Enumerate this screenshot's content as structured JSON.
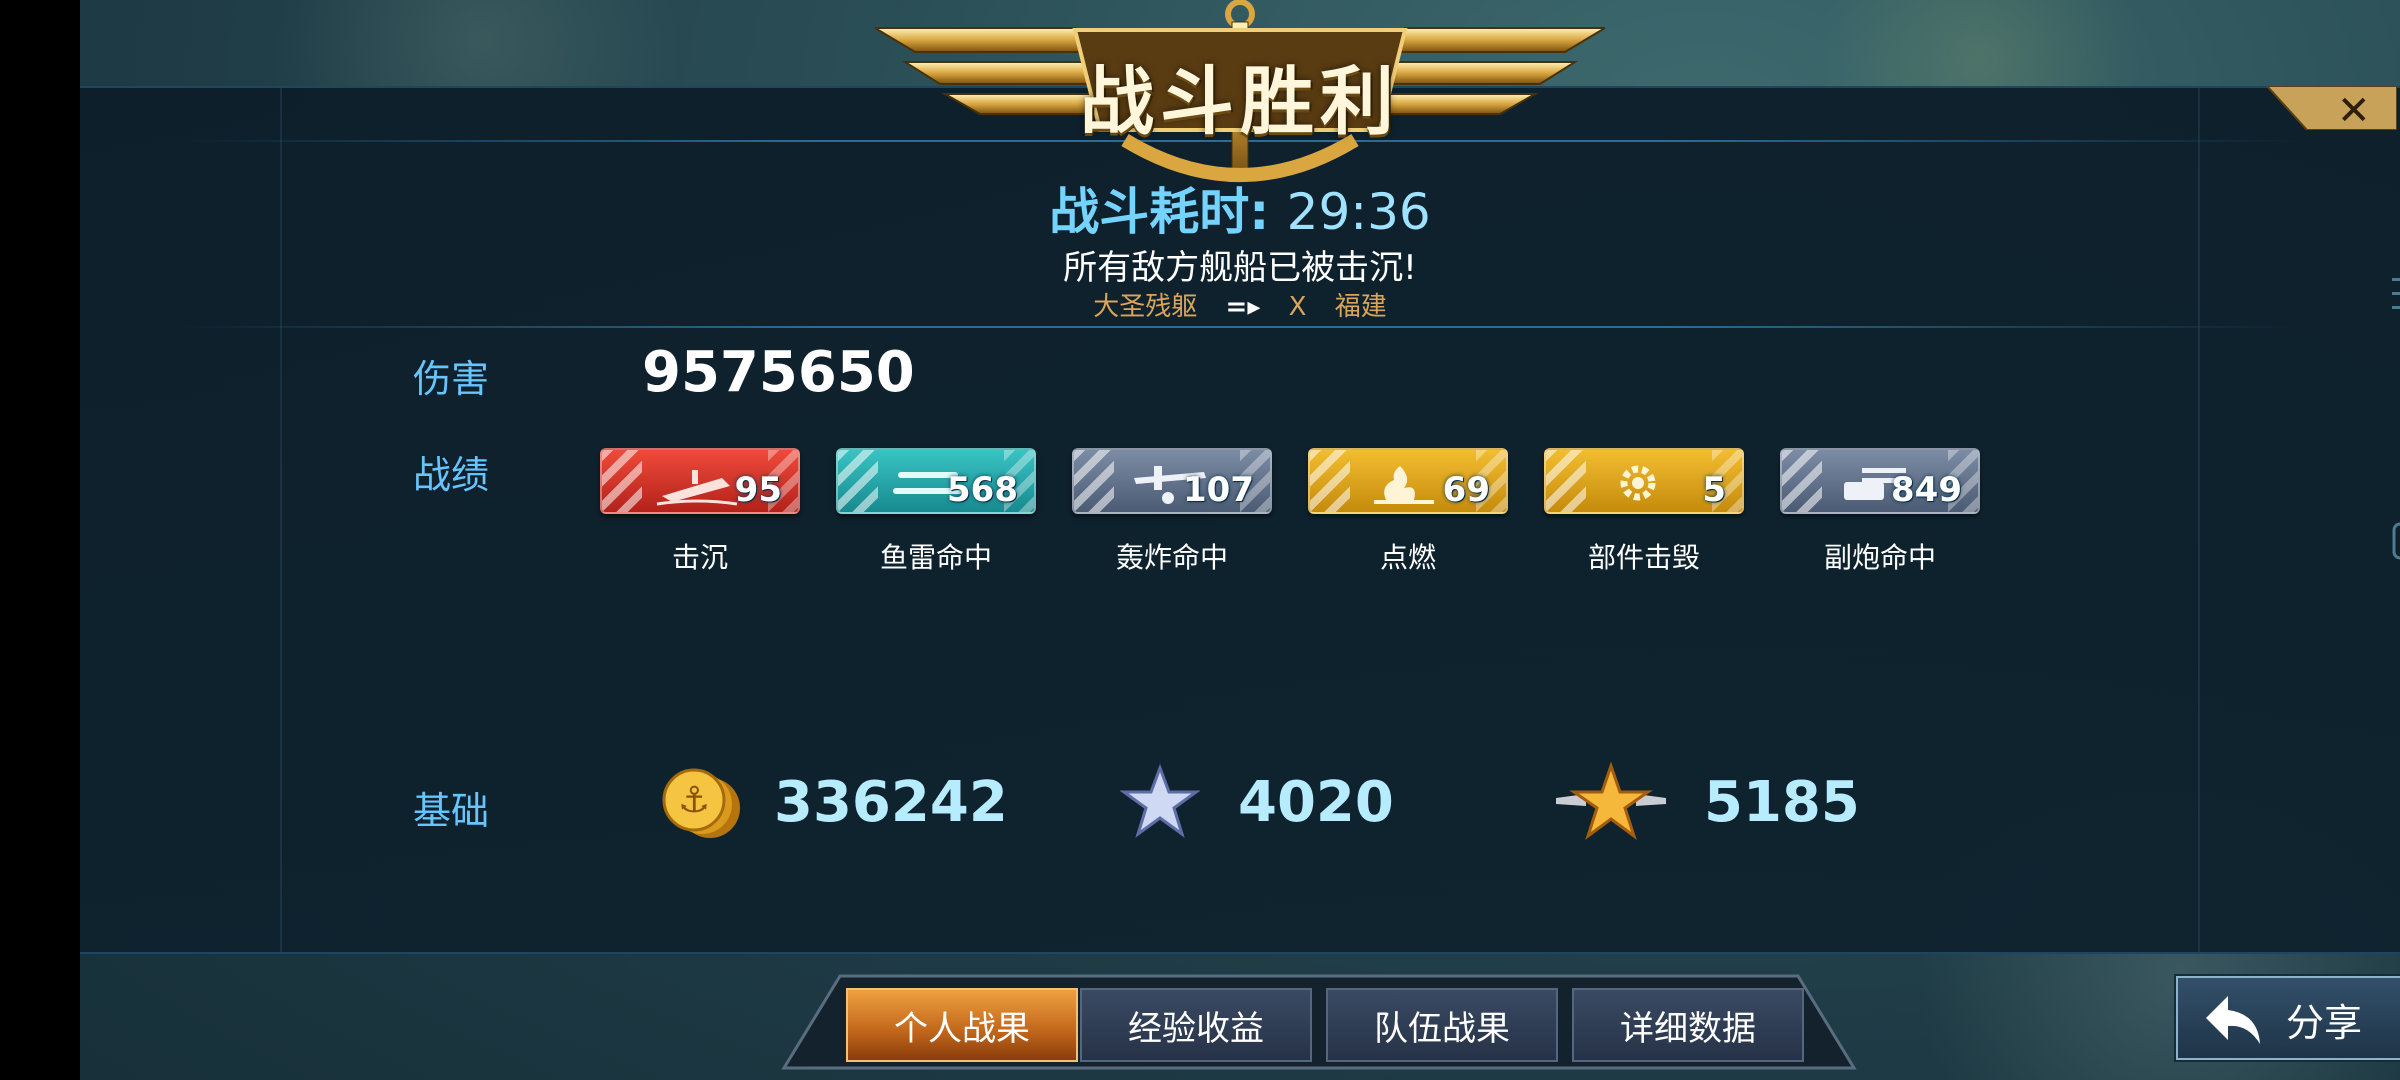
{
  "header": {
    "title": "战斗胜利",
    "battle_time_label": "战斗耗时:",
    "battle_time_value": "29:36",
    "all_sunk": "所有敌方舰船已被击沉!",
    "ship_from": "大圣残躯",
    "ship_x": "X",
    "ship_to": "福建"
  },
  "damage": {
    "label": "伤害",
    "value": "9575650"
  },
  "record": {
    "label": "战绩",
    "stats": [
      {
        "caption": "击沉",
        "value": "95",
        "icon": "sinking-ship-icon",
        "color": "#d9352a"
      },
      {
        "caption": "鱼雷命中",
        "value": "568",
        "icon": "torpedo-icon",
        "color": "#2aaeb0"
      },
      {
        "caption": "轰炸命中",
        "value": "107",
        "icon": "bomber-icon",
        "color": "#62728b"
      },
      {
        "caption": "点燃",
        "value": "69",
        "icon": "fire-icon",
        "color": "#e0a419"
      },
      {
        "caption": "部件击毁",
        "value": "5",
        "icon": "gear-icon",
        "color": "#e0a419"
      },
      {
        "caption": "副炮命中",
        "value": "849",
        "icon": "turret-icon",
        "color": "#62728b"
      }
    ]
  },
  "base": {
    "label": "基础",
    "coins": "336242",
    "silver_star": "4020",
    "gold_star": "5185"
  },
  "tabs": [
    {
      "label": "个人战果",
      "active": true
    },
    {
      "label": "经验收益",
      "active": false
    },
    {
      "label": "队伍战果",
      "active": false
    },
    {
      "label": "详细数据",
      "active": false
    }
  ],
  "share_label": "分享",
  "colors": {
    "accent_blue": "#68c4ff",
    "gold": "#e0a419"
  }
}
